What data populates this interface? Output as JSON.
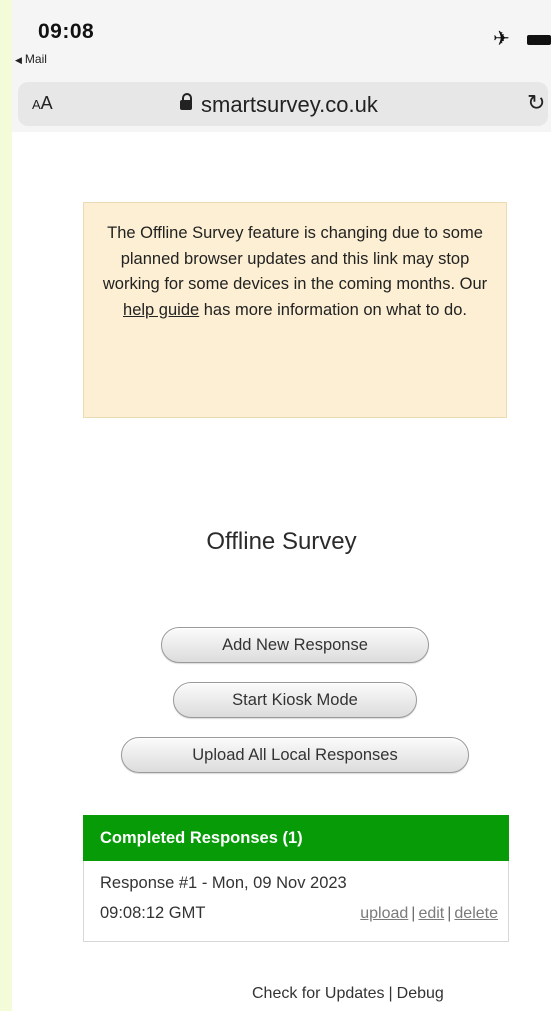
{
  "status_bar": {
    "time": "09:08",
    "back_app": "Mail",
    "icons": [
      "airplane-icon",
      "battery-icon"
    ]
  },
  "address_bar": {
    "text_size_label_small": "A",
    "text_size_label_large": "A",
    "url": "smartsurvey.co.uk"
  },
  "notice": {
    "text_before_link": "The Offline Survey feature is changing due to some planned browser updates and this link may stop working for some devices in the coming months. Our ",
    "link_text": "help guide",
    "text_after_link": " has more information on what to do."
  },
  "page_title": "Offline Survey",
  "buttons": {
    "add_new": "Add New Response",
    "kiosk": "Start Kiosk Mode",
    "upload_all": "Upload All Local Responses"
  },
  "responses": {
    "header": "Completed Responses (1)",
    "items": [
      {
        "line1": "Response #1 - Mon, 09 Nov 2023",
        "line2": "09:08:12 GMT",
        "actions": {
          "upload": "upload",
          "edit": "edit",
          "delete": "delete",
          "separator": "|"
        }
      }
    ]
  },
  "footer": {
    "check_updates": "Check for Updates",
    "separator": "|",
    "debug": "Debug"
  },
  "colors": {
    "accent_green": "#069b07",
    "notice_background": "#fcefd3",
    "outer_background": "#f3fbd9"
  }
}
